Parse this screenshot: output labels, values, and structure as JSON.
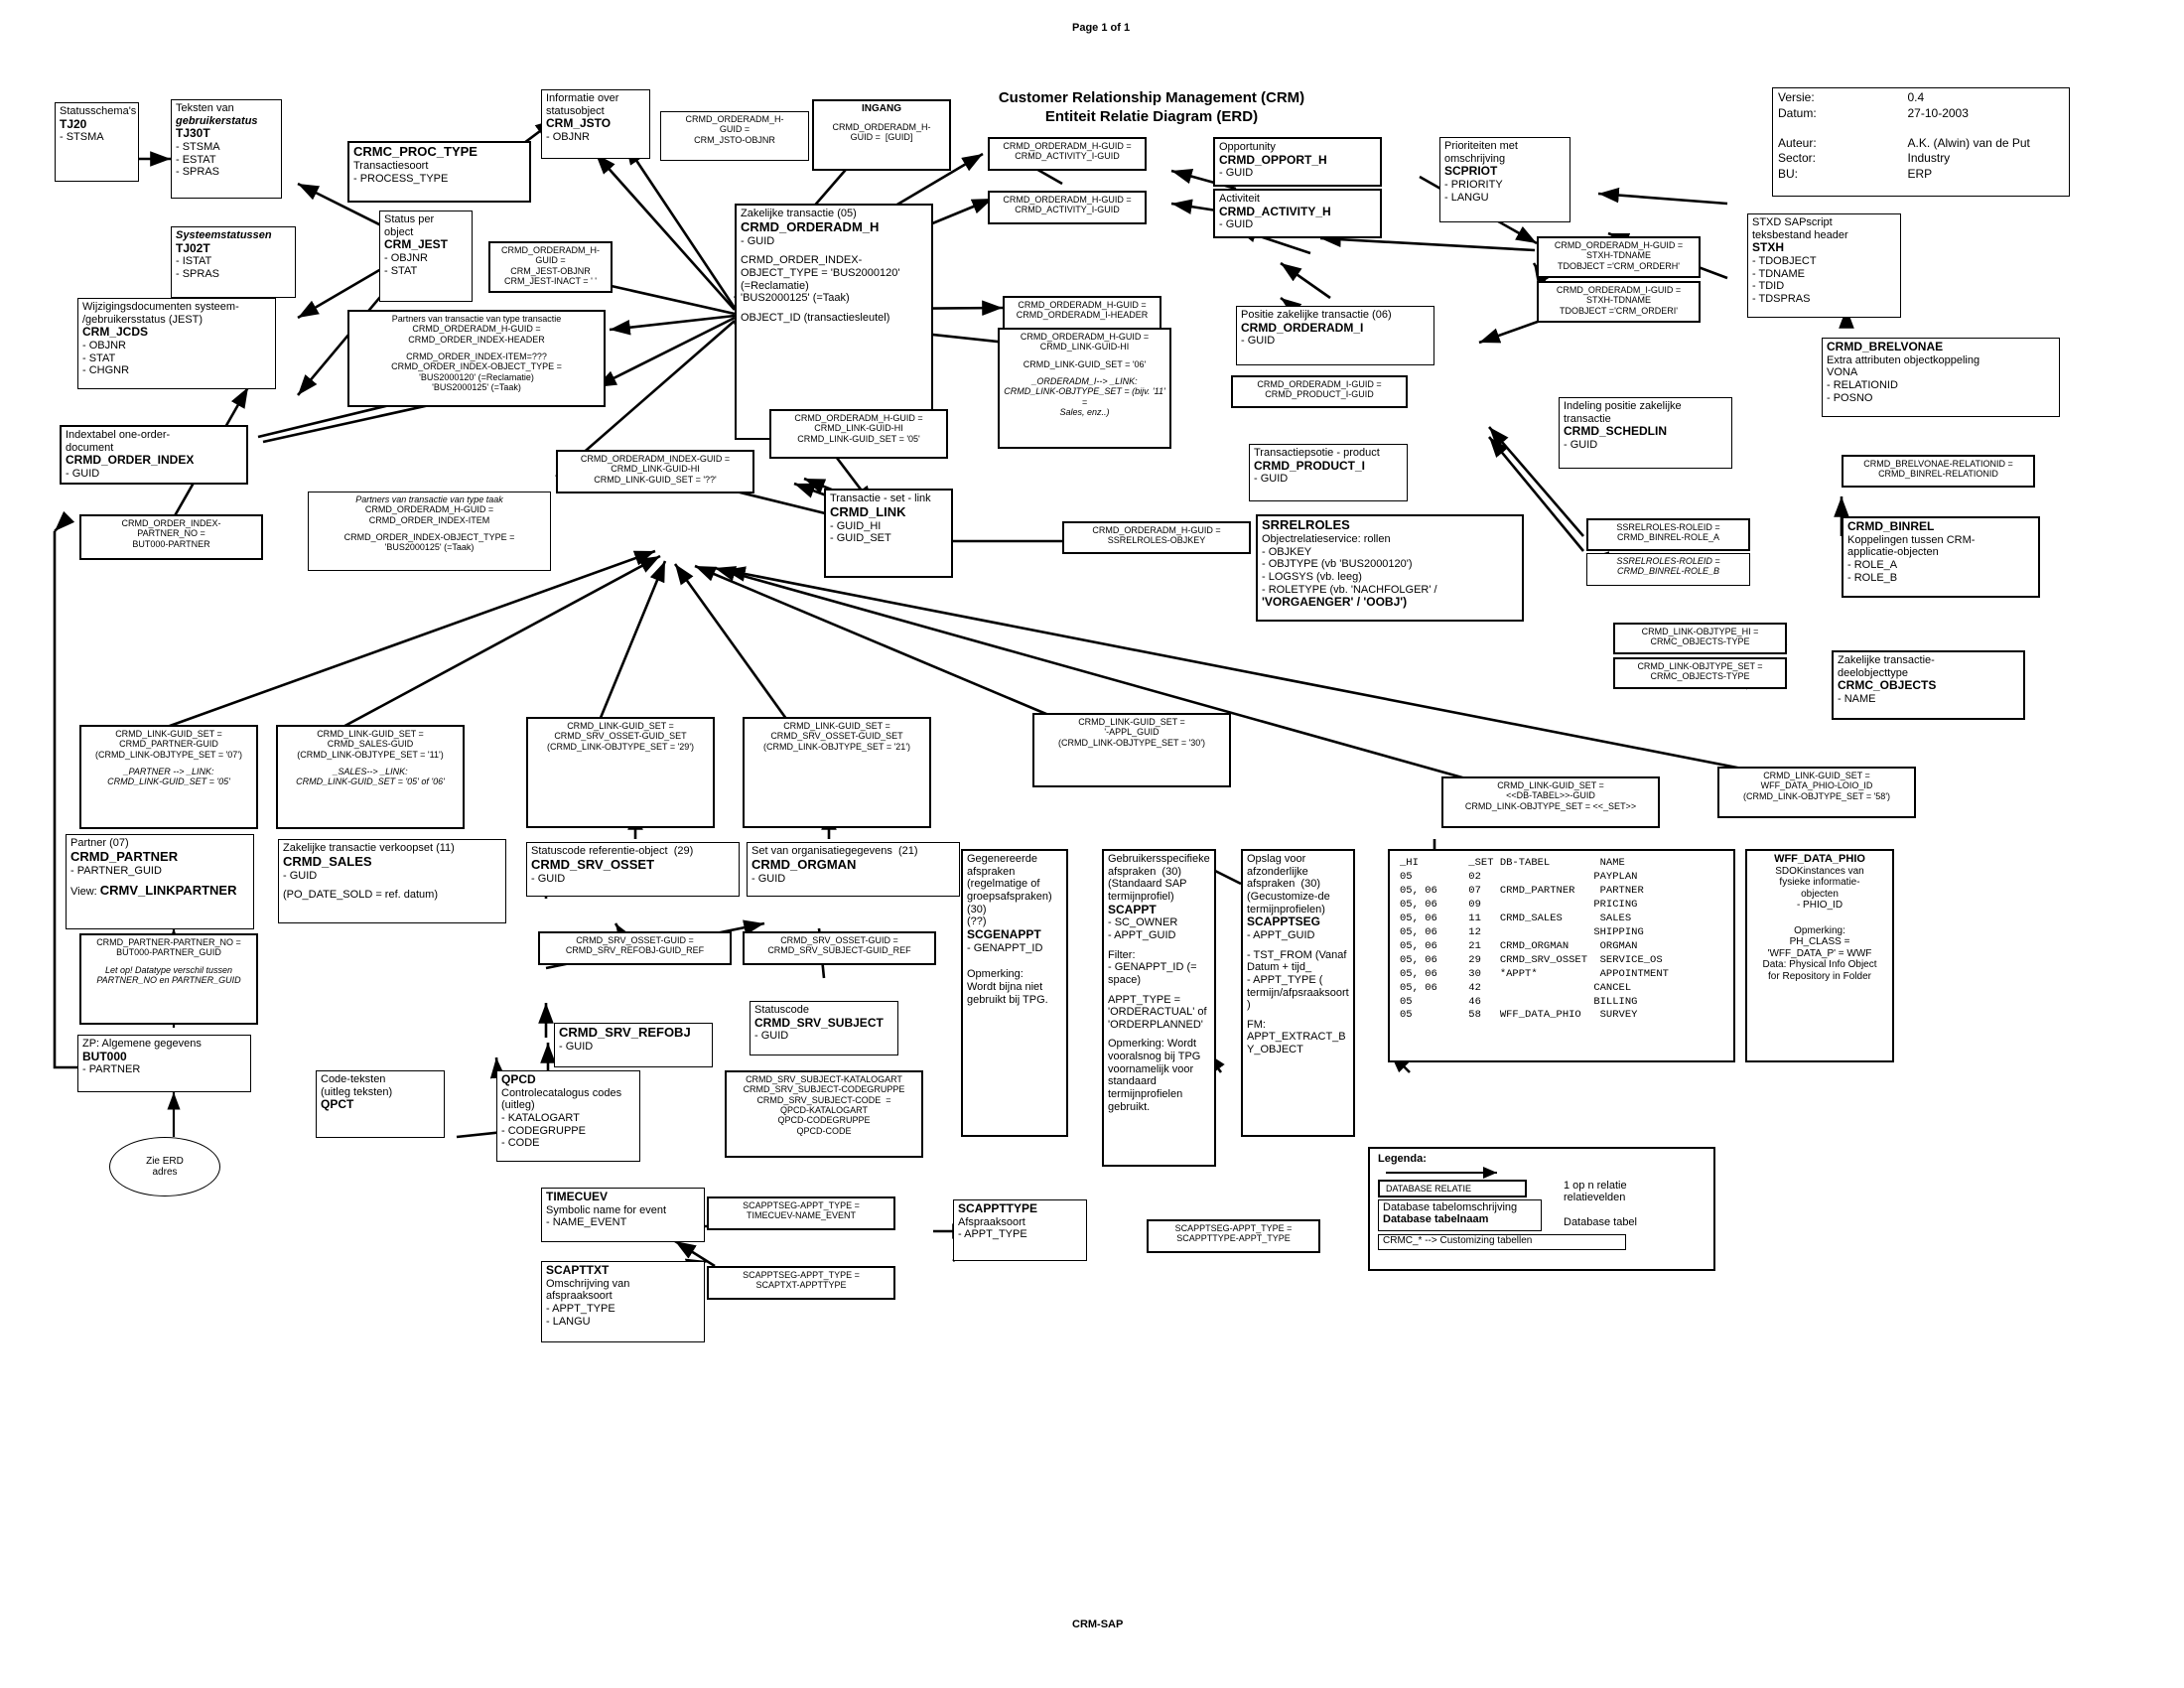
{
  "page": {
    "header": "Page 1 of 1",
    "footer": "CRM-SAP",
    "title_line1": "Customer Relationship Management (CRM)",
    "title_line2": "Entiteit Relatie Diagram (ERD)"
  },
  "meta": {
    "versie_label": "Versie:",
    "versie_value": "0.4",
    "datum_label": "Datum:",
    "datum_value": "27-10-2003",
    "auteur_label": "Auteur:",
    "auteur_value": "A.K. (Alwin) van de Put",
    "sector_label": "Sector:",
    "sector_value": "Industry",
    "bu_label": "BU:",
    "bu_value": "ERP"
  },
  "entities": {
    "tj20": {
      "desc": "Statusschema's",
      "name": "TJ20",
      "fields": "- STSMA"
    },
    "tj30t": {
      "desc": "Teksten van",
      "desc2": "gebruikerstatus",
      "name": "TJ30T",
      "fields": "- STSMA\n- ESTAT\n- SPRAS"
    },
    "tj02t": {
      "desc": "Systeemstatussen",
      "name": "TJ02T",
      "fields": "- ISTAT\n- SPRAS"
    },
    "crm_jcds": {
      "desc": "Wijzigingsdocumenten systeem-\n/gebruikersstatus (JEST)",
      "name": "CRM_JCDS",
      "fields": "- OBJNR\n- STAT\n- CHGNR"
    },
    "crmc_proc_type": {
      "name": "CRMC_PROC_TYPE",
      "desc": "Transactiesoort",
      "fields": "- PROCESS_TYPE"
    },
    "crm_jest": {
      "desc": "Status per\nobject",
      "name": "CRM_JEST",
      "fields": "- OBJNR\n- STAT"
    },
    "crm_jsto": {
      "desc": "Informatie over\nstatusobject",
      "name": "CRM_JSTO",
      "fields": "- OBJNR"
    },
    "crmd_order_index": {
      "desc": "Indextabel one-order-\ndocument",
      "name": "CRMD_ORDER_INDEX",
      "fields": "- GUID"
    },
    "crmd_orderadm_h": {
      "desc": "Zakelijke transactie (05)",
      "name": "CRMD_ORDERADM_H",
      "fields": "- GUID",
      "extra1": "CRMD_ORDER_INDEX-\nOBJECT_TYPE = 'BUS2000120'\n(=Reclamatie)\n'BUS2000125' (=Taak)",
      "extra2": "OBJECT_ID (transactiesleutel)"
    },
    "crmd_opport_h": {
      "desc": "Opportunity",
      "name": "CRMD_OPPORT_H",
      "fields": "- GUID"
    },
    "crmd_activity_h": {
      "desc": "Activiteit",
      "name": "CRMD_ACTIVITY_H",
      "fields": "- GUID"
    },
    "scpriot": {
      "desc": "Prioriteiten met\nomschrijving",
      "name": "SCPRIOT",
      "fields": "- PRIORITY\n- LANGU"
    },
    "stxh": {
      "desc": "STXD SAPscript\nteksbestand header",
      "name": "STXH",
      "fields": "- TDOBJECT\n- TDNAME\n- TDID\n- TDSPRAS"
    },
    "crmd_orderadm_i": {
      "desc": "Positie zakelijke transactie (06)",
      "name": "CRMD_ORDERADM_I",
      "fields": "- GUID"
    },
    "crmd_product_i": {
      "desc": "Transactiepsotie - product",
      "name": "CRMD_PRODUCT_I",
      "fields": "- GUID"
    },
    "crmd_schedlin": {
      "desc": "Indeling positie zakelijke\ntransactie",
      "name": "CRMD_SCHEDLIN",
      "fields": "- GUID"
    },
    "crmd_brelvonae": {
      "name": "CRMD_BRELVONAE",
      "desc": "Extra attributen objectkoppeling\nVONA",
      "fields": "- RELATIONID\n- POSNO"
    },
    "crmd_binrel": {
      "name": "CRMD_BINREL",
      "desc": "Koppelingen tussen CRM-\napplicatie-objecten",
      "fields": "- ROLE_A\n- ROLE_B"
    },
    "crmd_link": {
      "desc": "Transactie - set - link",
      "name": "CRMD_LINK",
      "fields": "- GUID_HI\n- GUID_SET"
    },
    "srrelroles": {
      "name": "SRRELROLES",
      "desc": "Objectrelatieservice: rollen",
      "fields": "- OBJKEY\n- OBJTYPE (vb 'BUS2000120')\n- LOGSYS (vb. leeg)\n- ROLETYPE (vb. 'NACHFOLGER' /",
      "fields_bold": "'VORGAENGER' / 'OOBJ')"
    },
    "crmc_objects": {
      "desc": "Zakelijke transactie-\ndeelobjecttype",
      "name": "CRMC_OBJECTS",
      "fields": "- NAME"
    },
    "crmd_partner": {
      "desc": "Partner (07)",
      "name": "CRMD_PARTNER",
      "fields": "- PARTNER_GUID",
      "view_label": "View: ",
      "view_value": "CRMV_LINKPARTNER"
    },
    "crmd_sales": {
      "desc": "Zakelijke transactie verkoopset (11)",
      "name": "CRMD_SALES",
      "fields": "- GUID",
      "note": "(PO_DATE_SOLD = ref. datum)"
    },
    "crmd_srv_osset": {
      "desc": "Statuscode referentie-object  (29)",
      "name": "CRMD_SRV_OSSET",
      "fields": "- GUID"
    },
    "crmd_orgman": {
      "desc": "Set van organisatiegegevens  (21)",
      "name": "CRMD_ORGMAN",
      "fields": "- GUID"
    },
    "crmd_srv_refobj": {
      "name": "CRMD_SRV_REFOBJ",
      "fields": "- GUID"
    },
    "crmd_srv_subject": {
      "desc": "Statuscode",
      "name": "CRMD_SRV_SUBJECT",
      "fields": "- GUID"
    },
    "but000": {
      "desc": "ZP: Algemene gegevens",
      "name": "BUT000",
      "fields": "- PARTNER"
    },
    "qpct": {
      "desc": "Code-teksten\n(uitleg teksten)",
      "name": "QPCT"
    },
    "qpcd": {
      "name": "QPCD",
      "desc": "Controlecatalogus codes\n(uitleg)",
      "fields": "- KATALOGART\n- CODEGRUPPE\n- CODE"
    },
    "timecuev": {
      "name": "TIMECUEV",
      "desc": "Symbolic name for event",
      "fields": "- NAME_EVENT"
    },
    "scapttxt": {
      "name": "SCAPTTXT",
      "desc": "Omschrijving van\nafspraaksoort",
      "fields": "- APPT_TYPE\n- LANGU"
    },
    "scappttype": {
      "name": "SCAPPTTYPE",
      "desc": "Afspraaksoort",
      "fields": "- APPT_TYPE"
    },
    "wff_data_phio": {
      "name": "WFF_DATA_PHIO",
      "desc": "SDOKinstances van\nfysieke informatie-\nobjecten",
      "fields": "- PHIO_ID",
      "note": "Opmerking:\nPH_CLASS =\n'WFF_DATA_P' = WWF\nData: Physical Info Object\nfor Repository in Folder"
    },
    "scgenappt": {
      "desc": "Gegenereerde\nafspraken\n(regelmatige of\ngroepsafspraken)\n(30)\n(??)",
      "name": "SCGENAPPT",
      "fields": "- GENAPPT_ID",
      "note": "Opmerking:\nWordt bijna niet\ngebruikt bij TPG."
    },
    "scappt": {
      "desc": "Gebruikersspecifieke\nafspraken  (30)\n(Standaard SAP\ntermijnprofiel)",
      "name": "SCAPPT",
      "fields": "- SC_OWNER\n- APPT_GUID",
      "note1": "Filter:\n- GENAPPT_ID (=\nspace)",
      "note2": "APPT_TYPE =\n'ORDERACTUAL' of\n'ORDERPLANNED'",
      "note3": "Opmerking: Wordt\nvooralsnog bij TPG\nvoornamelijk voor\nstandaard\ntermijnprofielen\ngebruikt."
    },
    "scapptseg": {
      "desc": "Opslag voor\nafzonderlijke\nafspraken  (30)\n(Gecustomize-de\ntermijnprofielen)",
      "name": "SCAPPTSEG",
      "fields": "- APPT_GUID",
      "note1": "- TST_FROM (Vanaf\nDatum + tijd_\n- APPT_TYPE (\ntermijn/afpsraaksoort\n)",
      "note2": "FM:\nAPPT_EXTRACT_B\nY_OBJECT"
    }
  },
  "relations": {
    "ingang": {
      "title": "INGANG",
      "text": "CRMD_ORDERADM_H-\nGUID =  [GUID]"
    },
    "h_jsto": {
      "text": "CRMD_ORDERADM_H-\nGUID =\nCRM_JSTO-OBJNR"
    },
    "h_jest": {
      "text": "CRMD_ORDERADM_H-\nGUID =\nCRM_JEST-OBJNR\nCRM_JEST-INACT = ' '"
    },
    "partners_taak": {
      "line1": "Partners van transactie van type transactie",
      "line2": "CRMD_ORDERADM_H-GUID =\nCRMD_ORDER_INDEX-HEADER",
      "line3": "CRMD_ORDER_INDEX-ITEM=???\nCRMD_ORDER_INDEX-OBJECT_TYPE =\n'BUS2000120' (=Reclamatie)\n'BUS2000125' (=Taak)"
    },
    "partners_typetaak": {
      "line1": "Partners van transactie van type taak",
      "line2": "CRMD_ORDERADM_H-GUID =\nCRMD_ORDER_INDEX-ITEM",
      "line3": "CRMD_ORDER_INDEX-OBJECT_TYPE =\n'BUS2000125' (=Taak)"
    },
    "h_activity_1": {
      "text": "CRMD_ORDERADM_H-GUID =\nCRMD_ACTIVITY_I-GUID"
    },
    "h_activity_2": {
      "text": "CRMD_ORDERADM_H-GUID =\nCRMD_ACTIVITY_I-GUID"
    },
    "h_i_header": {
      "text": "CRMD_ORDERADM_H-GUID =\nCRMD_ORDERADM_I-HEADER"
    },
    "h_link_hi": {
      "text": "CRMD_ORDERADM_H-GUID =\nCRMD_LINK-GUID-HI\nCRMD_LINK-GUID_SET = '05'"
    },
    "i_link_hi": {
      "text": "CRMD_ORDERADM_H-GUID =\nCRMD_LINK-GUID-HI",
      "text2": "CRMD_LINK-GUID_SET = '06'",
      "text3": "_ORDERADM_I--> _LINK:\nCRMD_LINK-OBJTYPE_SET = (bijv. '11' =\nSales, enz..)"
    },
    "index_guid": {
      "text": "CRMD_ORDERADM_INDEX-GUID =\nCRMD_LINK-GUID-HI\nCRMD_LINK-GUID_SET = '??'"
    },
    "index_partner": {
      "text": "CRMD_ORDER_INDEX-\nPARTNER_NO =\nBUT000-PARTNER"
    },
    "h_stxh": {
      "text": "CRMD_ORDERADM_H-GUID =\nSTXH-TDNAME\nTDOBJECT ='CRM_ORDERH'"
    },
    "i_stxh": {
      "text": "CRMD_ORDERADM_I-GUID =\nSTXH-TDNAME\nTDOBJECT ='CRM_ORDERI'"
    },
    "i_product": {
      "text": "CRMD_ORDERADM_I-GUID =\nCRMD_PRODUCT_I-GUID"
    },
    "h_srrelroles": {
      "text": "CRMD_ORDERADM_H-GUID =\nSSRELROLES-OBJKEY"
    },
    "brelvonae_binrel": {
      "text": "CRMD_BRELVONAE-RELATIONID =\nCRMD_BINREL-RELATIONID"
    },
    "roleid_a": {
      "text": "SSRELROLES-ROLEID =\nCRMD_BINREL-ROLE_A"
    },
    "roleid_b": {
      "text": "SSRELROLES-ROLEID =\nCRMD_BINREL-ROLE_B"
    },
    "objtype_hi": {
      "text": "CRMD_LINK-OBJTYPE_HI =\nCRMC_OBJECTS-TYPE"
    },
    "objtype_set": {
      "text": "CRMD_LINK-OBJTYPE_SET =\nCRMC_OBJECTS-TYPE"
    },
    "link_partner": {
      "text": "CRMD_LINK-GUID_SET =\nCRMD_PARTNER-GUID\n(CRMD_LINK-OBJTYPE_SET = '07')",
      "text2": "_PARTNER --> _LINK:\nCRMD_LINK-GUID_SET = '05'"
    },
    "link_sales": {
      "text": "CRMD_LINK-GUID_SET =\nCRMD_SALES-GUID\n(CRMD_LINK-OBJTYPE_SET = '11')",
      "text2": "_SALES--> _LINK:\nCRMD_LINK-GUID_SET = '05' of '06'"
    },
    "link_osset29": {
      "text": "CRMD_LINK-GUID_SET =\nCRMD_SRV_OSSET-GUID_SET\n(CRMD_LINK-OBJTYPE_SET = '29')"
    },
    "link_osset21": {
      "text": "CRMD_LINK-GUID_SET =\nCRMD_SRV_OSSET-GUID_SET\n(CRMD_LINK-OBJTYPE_SET = '21')"
    },
    "link_appt": {
      "text": "CRMD_LINK-GUID_SET =\n'-APPL_GUID\n(CRMD_LINK-OBJTYPE_SET = '30')"
    },
    "link_dbtabel": {
      "text": "CRMD_LINK-GUID_SET =\n<<DB-TABEL>>-GUID\nCRMD_LINK-OBJTYPE_SET = <<_SET>>"
    },
    "link_wff": {
      "text": "CRMD_LINK-GUID_SET =\nWFF_DATA_PHIO-LOIO_ID\n(CRMD_LINK-OBJTYPE_SET = '58')"
    },
    "osset_refobj": {
      "text": "CRMD_SRV_OSSET-GUID =\nCRMD_SRV_REFOBJ-GUID_REF"
    },
    "osset_subject": {
      "text": "CRMD_SRV_OSSET-GUID =\nCRMD_SRV_SUBJECT-GUID_REF"
    },
    "subject_qpcd": {
      "text": "CRMD_SRV_SUBJECT-KATALOGART\nCRMD_SRV_SUBJECT-CODEGRUPPE\nCRMD_SRV_SUBJECT-CODE  =\nQPCD-KATALOGART\nQPCD-CODEGRUPPE\nQPCD-CODE"
    },
    "partner_but000": {
      "text": "CRMD_PARTNER-PARTNER_NO =\nBUT000-PARTNER_GUID",
      "text2": "Let op! Datatype verschil tussen\nPARTNER_NO en PARTNER_GUID"
    },
    "scapptseg_timecuev": {
      "text": "SCAPPTSEG-APPT_TYPE =\nTIMECUEV-NAME_EVENT"
    },
    "scapptseg_scaptxt": {
      "text": "SCAPPTSEG-APPT_TYPE =\nSCAPTXT-APPTTYPE"
    },
    "scapptseg_type": {
      "text": "SCAPPTSEG-APPT_TYPE =\nSCAPPTTYPE-APPT_TYPE"
    }
  },
  "zie_erd": "Zie ERD\nadres",
  "table": {
    "header": "_HI        _SET DB-TABEL        NAME",
    "rows": [
      "05         02                  PAYPLAN",
      "05, 06     07   CRMD_PARTNER    PARTNER",
      "05, 06     09                  PRICING",
      "05, 06     11   CRMD_SALES      SALES",
      "05, 06     12                  SHIPPING",
      "05, 06     21   CRMD_ORGMAN     ORGMAN",
      "05, 06     29   CRMD_SRV_OSSET  SERVICE_OS",
      "05, 06     30   *APPT*          APPOINTMENT",
      "05, 06     42                  CANCEL",
      "05         46                  BILLING",
      "05         58   WFF_DATA_PHIO   SURVEY"
    ]
  },
  "legend": {
    "title": "Legenda:",
    "rel_box": "DATABASE RELATIE",
    "rel_caption": "1 op n relatie\nrelatievelden",
    "tbl_desc": "Database tabelomschrijving",
    "tbl_name": "Database tabelnaam",
    "tbl_caption": "Database tabel",
    "crmc_note": "CRMC_* --> Customizing tabellen"
  }
}
